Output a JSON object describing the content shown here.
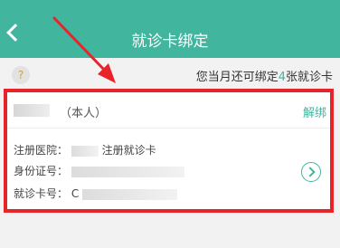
{
  "header": {
    "title": "就诊卡绑定",
    "back_icon": "chevron-left-icon"
  },
  "notice": {
    "help_glyph": "?",
    "prefix": "您当月还可绑定",
    "count": "4",
    "suffix": "张就诊卡"
  },
  "card": {
    "self_tag": "（本人）",
    "unbind_label": "解绑",
    "hospital_label": "注册医院：",
    "hospital_value": "注册就诊卡",
    "id_label": "身份证号：",
    "card_label": "就诊卡号：",
    "card_value_start": "C",
    "go_icon": "chevron-right-circle-icon"
  },
  "colors": {
    "accent": "#42b59e",
    "annotation": "#e8242a"
  }
}
